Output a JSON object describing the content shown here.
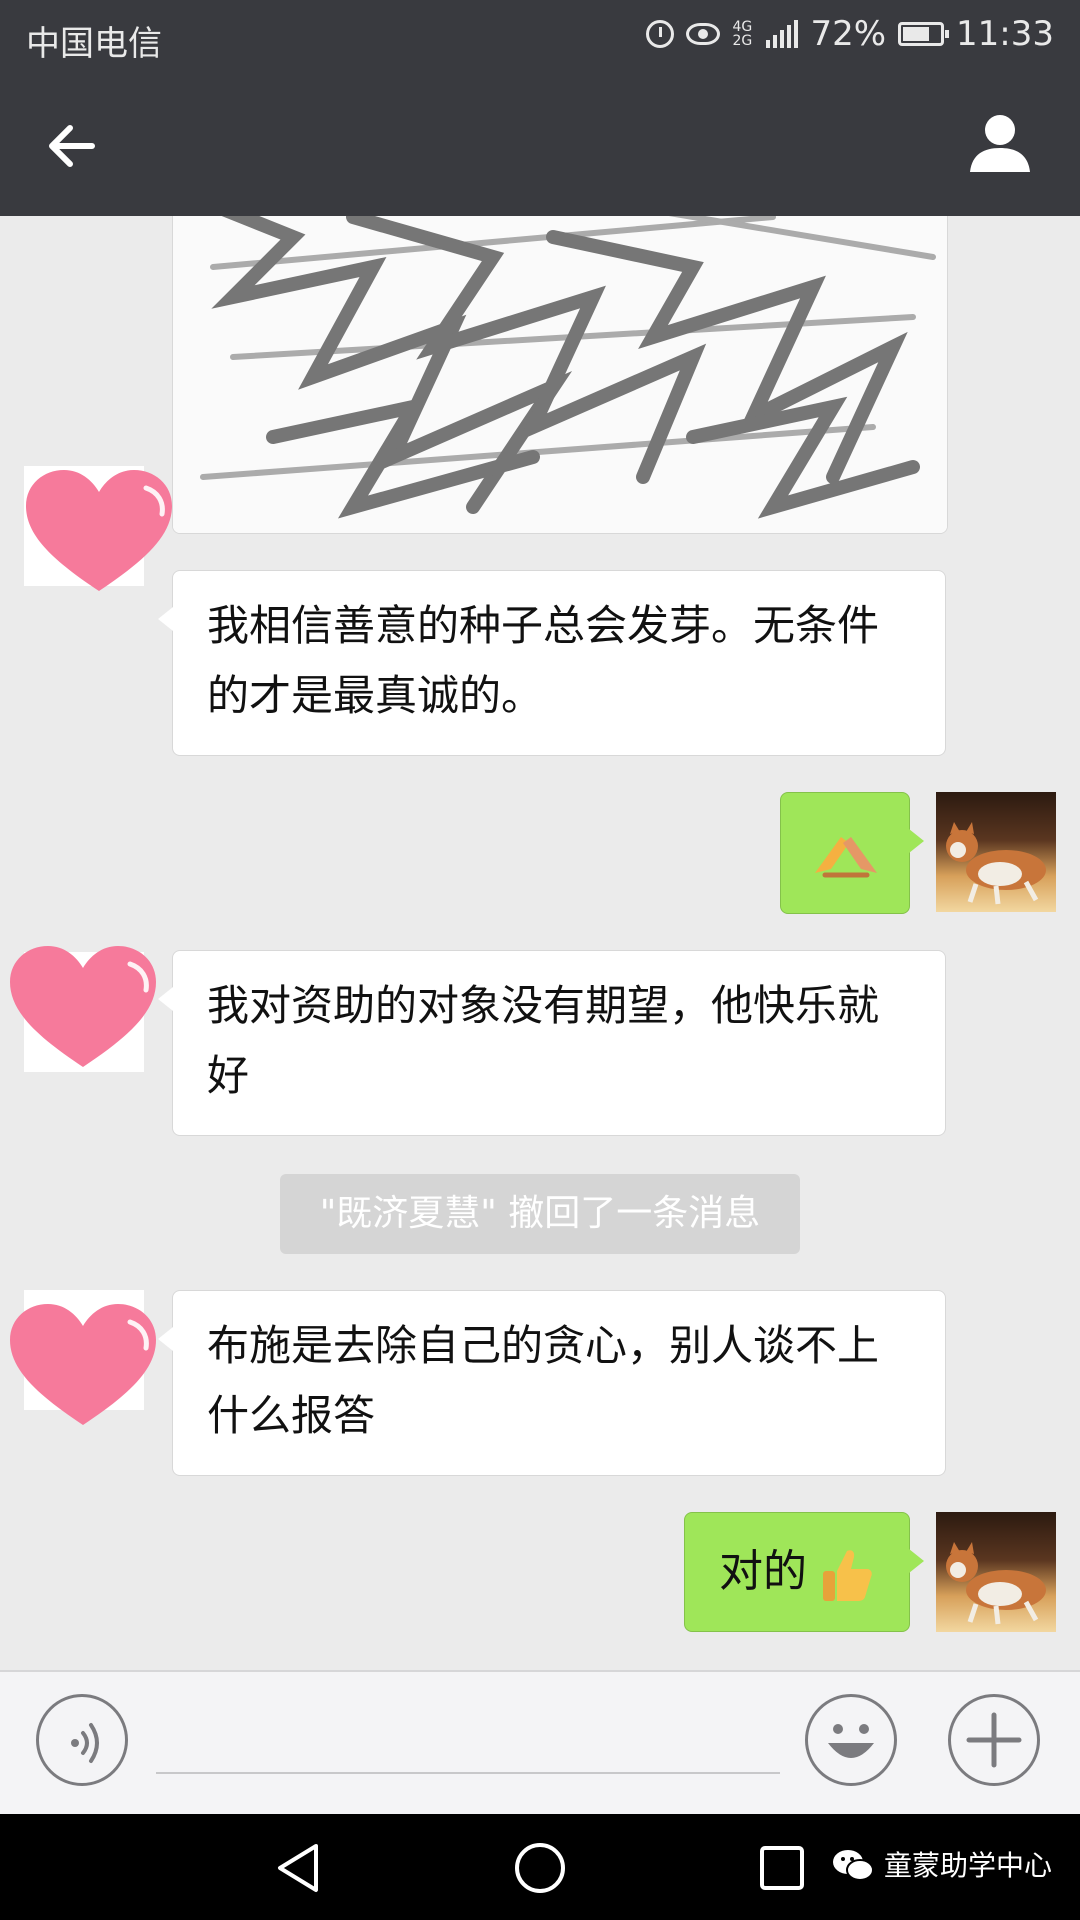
{
  "status_bar": {
    "carrier": "中国电信",
    "network": "4G 2G",
    "battery": "72%",
    "battery_level": 0.72,
    "time": "11:33",
    "icons": [
      "alarm-icon",
      "eye-icon",
      "signal-icon",
      "battery-icon"
    ]
  },
  "title_bar": {
    "back_icon": "arrow-left-icon",
    "profile_icon": "person-icon"
  },
  "messages": [
    {
      "sender": "contact",
      "avatar": "heart-avatar",
      "text": "我相信善意的种子总会发芽。无条件的才是最真诚的。"
    },
    {
      "sender": "me",
      "avatar": "cat-avatar",
      "emoji": "handshake-emoji"
    },
    {
      "sender": "contact",
      "avatar": "heart-avatar",
      "text": "我对资助的对象没有期望，他快乐就好"
    },
    {
      "sender": "contact",
      "avatar": "heart-avatar",
      "text": "布施是去除自己的贪心，别人谈不上什么报答"
    },
    {
      "sender": "me",
      "avatar": "cat-avatar",
      "text": "对的",
      "emoji": "thumbs-up-emoji"
    }
  ],
  "system_notice": "\"既济夏慧\" 撤回了一条消息",
  "input_bar": {
    "voice_icon": "voice-icon",
    "emoji_icon": "smiley-icon",
    "more_icon": "plus-icon"
  },
  "nav_bar": {
    "icons": [
      "back-triangle-icon",
      "home-circle-icon",
      "recent-square-icon"
    ]
  },
  "watermark": {
    "icon": "wechat-icon",
    "text": "童蒙助学中心"
  },
  "colors": {
    "header_bg": "#393a3f",
    "chat_bg": "#ebebeb",
    "outgoing_bubble": "#9fe659",
    "incoming_bubble": "#ffffff"
  }
}
